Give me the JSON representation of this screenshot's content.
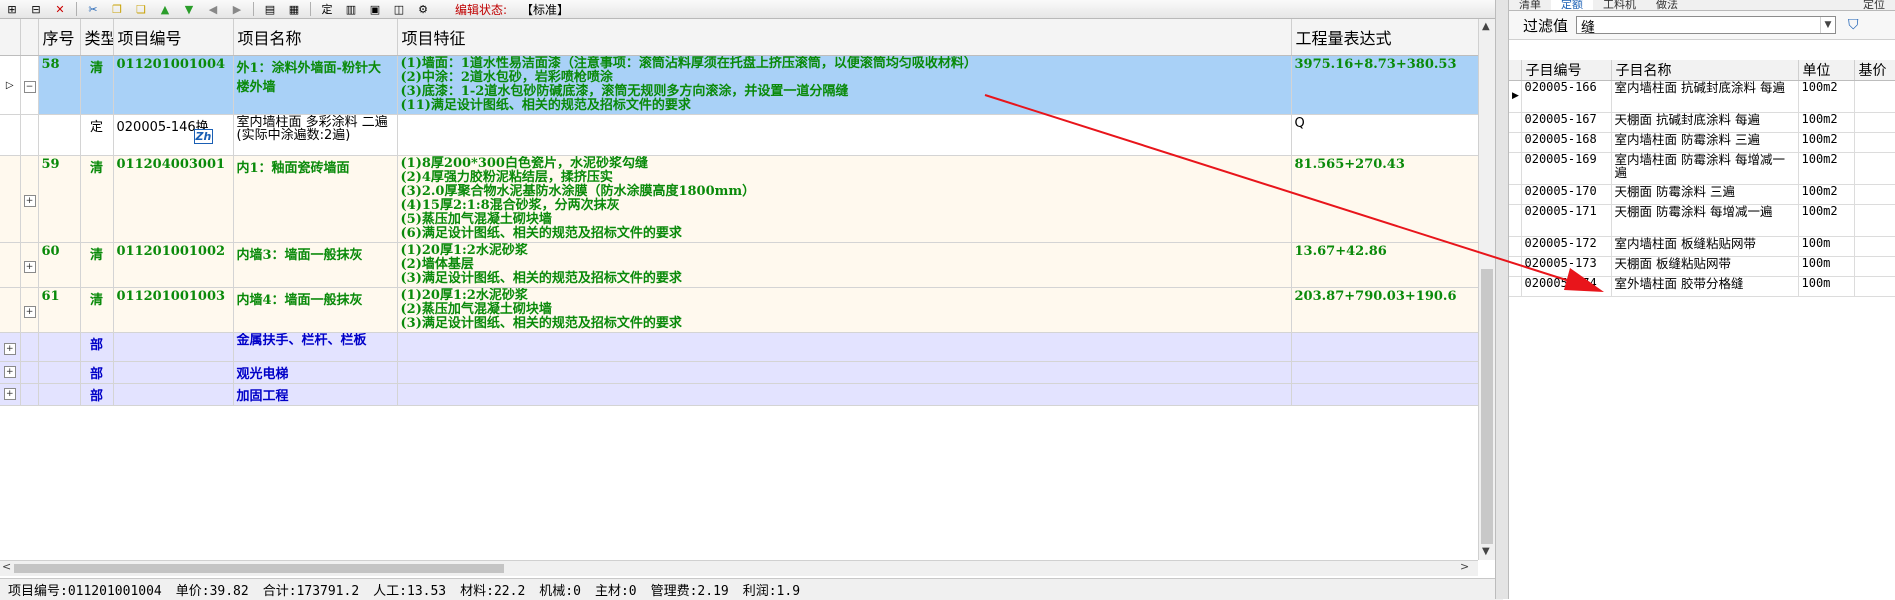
{
  "toolbar": {
    "edit_status_label": "编辑状态:",
    "edit_status_value": "【标准】"
  },
  "grid": {
    "headers": {
      "seq": "序号",
      "type": "类型",
      "code": "项目编号",
      "name": "项目名称",
      "feature": "项目特征",
      "expr": "工程量表达式"
    },
    "rows": [
      {
        "seq": "58",
        "type": "清",
        "code": "011201001004",
        "name": "外1：涂料外墙面-粉针大楼外墙",
        "feature": "(1)墙面：1道水性易洁面漆（注意事项：滚筒沾料厚须在托盘上挤压滚筒，以便滚筒均匀吸收材料）\n(2)中涂：2道水包砂，岩彩喷枪喷涂\n(3)底漆：1-2道水包砂防碱底漆，滚筒无规则多方向滚涂，并设置一道分隔缝\n(11)满足设计图纸、相关的规范及招标文件的要求",
        "expr": "3975.16+8.73+380.53"
      },
      {
        "seq": "",
        "type": "定",
        "code": "020005-146换",
        "badge": "Zh",
        "name": "室内墙柱面 多彩涂料 二遍(实际中涂遍数:2遍)",
        "feature": "",
        "expr": "Q"
      },
      {
        "seq": "59",
        "type": "清",
        "code": "011204003001",
        "name": "内1：釉面瓷砖墙面",
        "feature": "(1)8厚200*300白色瓷片，水泥砂浆勾缝\n(2)4厚强力胶粉泥粘结层，揉挤压实\n(3)2.0厚聚合物水泥基防水涂膜（防水涂膜高度1800mm）\n(4)15厚2:1:8混合砂浆，分两次抹灰\n(5)蒸压加气混凝土砌块墙\n(6)满足设计图纸、相关的规范及招标文件的要求",
        "expr": "81.565+270.43"
      },
      {
        "seq": "60",
        "type": "清",
        "code": "011201001002",
        "name": "内墙3：墙面一般抹灰",
        "feature": "(1)20厚1:2水泥砂浆\n(2)墙体基层\n(3)满足设计图纸、相关的规范及招标文件的要求",
        "expr": "13.67+42.86"
      },
      {
        "seq": "61",
        "type": "清",
        "code": "011201001003",
        "name": "内墙4：墙面一般抹灰",
        "feature": "(1)20厚1:2水泥砂浆\n(2)蒸压加气混凝土砌块墙\n(3)满足设计图纸、相关的规范及招标文件的要求",
        "expr": "203.87+790.03+190.6"
      },
      {
        "type": "部",
        "name": "金属扶手、栏杆、栏板"
      },
      {
        "type": "部",
        "name": "观光电梯"
      },
      {
        "type": "部",
        "name": "加固工程"
      }
    ]
  },
  "statusbar": {
    "code": "项目编号:011201001004",
    "unit_price": "单价:39.82",
    "total": "合计:173791.2",
    "labor": "人工:13.53",
    "material": "材料:22.2",
    "machine": "机械:0",
    "main_material": "主材:0",
    "mgmt": "管理费:2.19",
    "profit": "利润:1.9"
  },
  "right_panel": {
    "tabs": [
      "清单",
      "定额",
      "工料机",
      "做法",
      "定位"
    ],
    "filter_label": "过滤值",
    "filter_value": "缝",
    "headers": {
      "code": "子目编号",
      "name": "子目名称",
      "unit": "单位",
      "price": "基价"
    },
    "rows": [
      {
        "code": "020005-166",
        "name": "室内墙柱面 抗碱封底涂料 每遍",
        "unit": "100m2"
      },
      {
        "code": "020005-167",
        "name": "天棚面 抗碱封底涂料 每遍",
        "unit": "100m2"
      },
      {
        "code": "020005-168",
        "name": "室内墙柱面 防霉涂料 三遍",
        "unit": "100m2"
      },
      {
        "code": "020005-169",
        "name": "室内墙柱面 防霉涂料 每增减一遍",
        "unit": "100m2"
      },
      {
        "code": "020005-170",
        "name": "天棚面 防霉涂料 三遍",
        "unit": "100m2"
      },
      {
        "code": "020005-171",
        "name": "天棚面 防霉涂料 每增减一遍",
        "unit": "100m2"
      },
      {
        "code": "020005-172",
        "name": "室内墙柱面 板缝粘贴网带",
        "unit": "100m"
      },
      {
        "code": "020005-173",
        "name": "天棚面 板缝粘贴网带",
        "unit": "100m"
      },
      {
        "code": "020005-174",
        "name": "室外墙柱面 胶带分格缝",
        "unit": "100m"
      }
    ]
  },
  "annotation": {
    "arrow_color": "#e8151b"
  }
}
